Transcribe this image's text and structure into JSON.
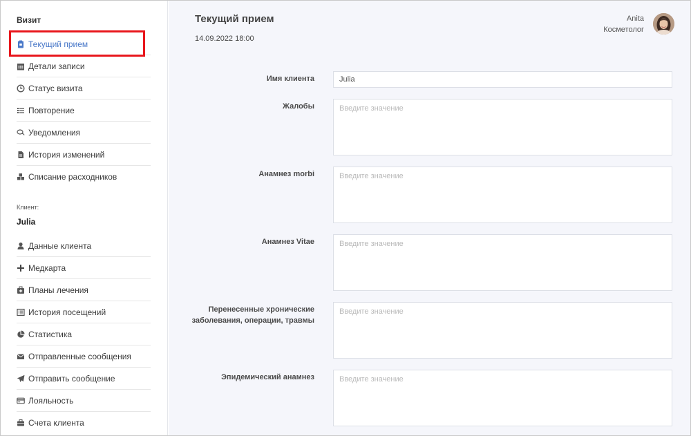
{
  "sidebar": {
    "visit_title": "Визит",
    "visit_items": [
      {
        "label": "Текущий прием",
        "icon": "clipboard-icon"
      },
      {
        "label": "Детали записи",
        "icon": "calendar-icon"
      },
      {
        "label": "Статус визита",
        "icon": "clock-icon"
      },
      {
        "label": "Повторение",
        "icon": "list-icon"
      },
      {
        "label": "Уведомления",
        "icon": "chat-icon"
      },
      {
        "label": "История изменений",
        "icon": "file-icon"
      },
      {
        "label": "Списание расходников",
        "icon": "cubes-icon"
      }
    ],
    "client_label": "Клиент:",
    "client_name": "Julia",
    "client_items": [
      {
        "label": "Данные клиента",
        "icon": "user-icon"
      },
      {
        "label": "Медкарта",
        "icon": "plus-icon"
      },
      {
        "label": "Планы лечения",
        "icon": "medkit-icon"
      },
      {
        "label": "История посещений",
        "icon": "list-alt-icon"
      },
      {
        "label": "Статистика",
        "icon": "pie-chart-icon"
      },
      {
        "label": "Отправленные сообщения",
        "icon": "envelope-icon"
      },
      {
        "label": "Отправить сообщение",
        "icon": "paper-plane-icon"
      },
      {
        "label": "Лояльность",
        "icon": "credit-card-icon"
      },
      {
        "label": "Счета клиента",
        "icon": "briefcase-icon"
      }
    ]
  },
  "header": {
    "title": "Текущий прием",
    "date": "14.09.2022 18:00",
    "user_name": "Anita",
    "user_role": "Косметолог"
  },
  "form": {
    "client_name_label": "Имя клиента",
    "client_name_value": "Julia",
    "placeholder": "Введите значение",
    "fields": [
      {
        "label": "Жалобы"
      },
      {
        "label": "Анамнез morbi"
      },
      {
        "label": "Анамнез Vitae"
      },
      {
        "label": "Перенесенные хронические заболевания, операции, травмы"
      },
      {
        "label": "Эпидемический анамнез"
      }
    ]
  },
  "colors": {
    "accent": "#4a79c9",
    "highlight": "#e8161c",
    "main_bg": "#f5f6fb"
  }
}
